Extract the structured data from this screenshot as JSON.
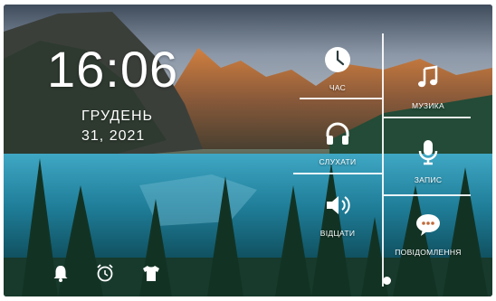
{
  "status": {
    "time": "16:06",
    "month": "ГРУДЕНЬ",
    "day_year": "31, 2021"
  },
  "menu": {
    "clock": "ЧАС",
    "music": "МУЗИКА",
    "listen": "СЛУХАТИ",
    "record": "ЗАПИС",
    "ring": "ВІДЦАТИ",
    "messages": "ПОВІДОМЛЕННЯ"
  },
  "icons": {
    "clock": "clock-icon",
    "music": "music-note-icon",
    "listen": "headphones-icon",
    "record": "microphone-icon",
    "ring": "speaker-icon",
    "messages": "chat-bubble-icon",
    "bell": "bell-icon",
    "alarm": "alarm-clock-icon",
    "shirt": "shirt-icon"
  },
  "colors": {
    "foreground": "#ffffff"
  }
}
